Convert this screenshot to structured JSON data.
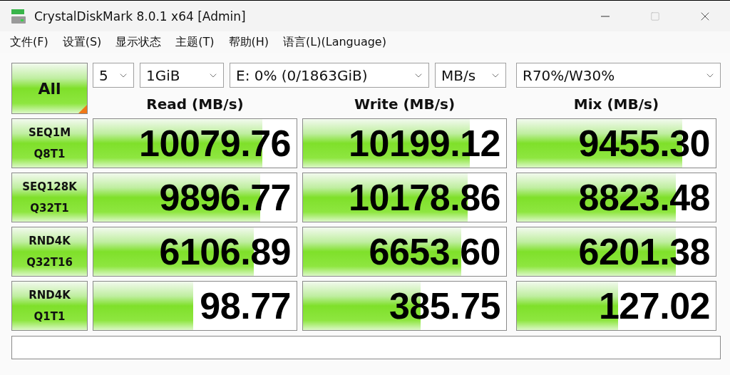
{
  "window": {
    "title": "CrystalDiskMark 8.0.1 x64 [Admin]"
  },
  "menu": [
    "文件(F)",
    "设置(S)",
    "显示状态",
    "主题(T)",
    "帮助(H)",
    "语言(L)(Language)"
  ],
  "all_button": {
    "label": "All"
  },
  "selectors": [
    {
      "value": "5"
    },
    {
      "value": "1GiB"
    },
    {
      "value": "E: 0% (0/1863GiB)"
    },
    {
      "value": "MB/s"
    },
    {
      "value": "R70%/W30%"
    }
  ],
  "columns": [
    "Read (MB/s)",
    "Write (MB/s)",
    "Mix (MB/s)"
  ],
  "rows": [
    {
      "name": "SEQ1M",
      "params": "Q8T1",
      "results": [
        {
          "value": "10079.76",
          "level": 0.83
        },
        {
          "value": "10199.12",
          "level": 0.82
        },
        {
          "value": "9455.30",
          "level": 0.83
        }
      ]
    },
    {
      "name": "SEQ128K",
      "params": "Q32T1",
      "results": [
        {
          "value": "9896.77",
          "level": 0.82
        },
        {
          "value": "10178.86",
          "level": 0.81
        },
        {
          "value": "8823.48",
          "level": 0.8
        }
      ]
    },
    {
      "name": "RND4K",
      "params": "Q32T16",
      "results": [
        {
          "value": "6106.89",
          "level": 0.79
        },
        {
          "value": "6653.60",
          "level": 0.78
        },
        {
          "value": "6201.38",
          "level": 0.8
        }
      ]
    },
    {
      "name": "RND4K",
      "params": "Q1T1",
      "results": [
        {
          "value": "98.77",
          "level": 0.49
        },
        {
          "value": "385.75",
          "level": 0.58
        },
        {
          "value": "127.02",
          "level": 0.51
        }
      ]
    }
  ]
}
